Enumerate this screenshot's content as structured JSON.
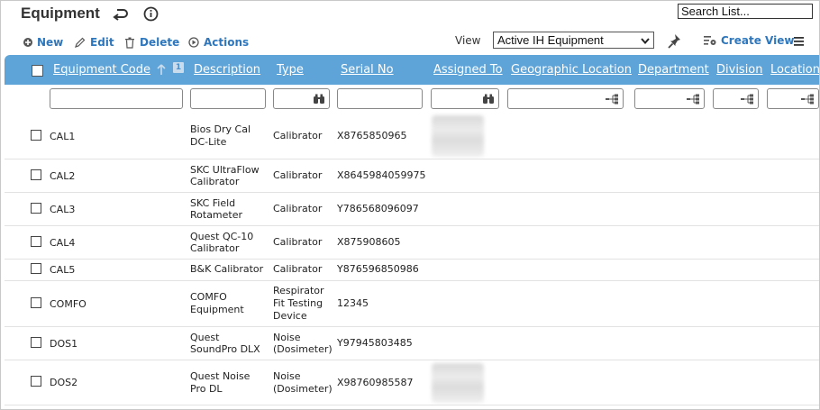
{
  "page": {
    "title": "Equipment",
    "search_placeholder": "Search List..."
  },
  "toolbar": {
    "new_label": "New",
    "edit_label": "Edit",
    "delete_label": "Delete",
    "actions_label": "Actions",
    "view_label": "View",
    "view_selected": "Active IH Equipment",
    "create_view_label": "Create View"
  },
  "colors": {
    "header_bg": "#5fa4d8",
    "link_blue": "#2e77bd"
  },
  "columns": {
    "code": "Equipment Code",
    "sort_badge": "1",
    "description": "Description",
    "type": "Type",
    "serial": "Serial No",
    "assigned": "Assigned To",
    "geo": "Geographic Location",
    "department": "Department",
    "division": "Division",
    "location": "Location"
  },
  "rows": [
    {
      "code": "CAL1",
      "desc1": "Bios Dry Cal",
      "desc2": "DC-Lite",
      "type1": "Calibrator",
      "type2": "",
      "type3": "",
      "serial": "X8765850965"
    },
    {
      "code": "CAL2",
      "desc1": "SKC UltraFlow",
      "desc2": "Calibrator",
      "type1": "Calibrator",
      "type2": "",
      "type3": "",
      "serial": "X8645984059975"
    },
    {
      "code": "CAL3",
      "desc1": "SKC Field",
      "desc2": "Rotameter",
      "type1": "Calibrator",
      "type2": "",
      "type3": "",
      "serial": "Y786568096097"
    },
    {
      "code": "CAL4",
      "desc1": "Quest QC-10",
      "desc2": "Calibrator",
      "type1": "Calibrator",
      "type2": "",
      "type3": "",
      "serial": "X875908605"
    },
    {
      "code": "CAL5",
      "desc1": "B&K Calibrator",
      "desc2": "",
      "type1": "Calibrator",
      "type2": "",
      "type3": "",
      "serial": "Y876596850986"
    },
    {
      "code": "COMFO",
      "desc1": "COMFO",
      "desc2": "Equipment",
      "type1": "Respirator",
      "type2": "Fit Testing",
      "type3": "Device",
      "serial": "12345"
    },
    {
      "code": "DOS1",
      "desc1": "Quest",
      "desc2": "SoundPro DLX",
      "type1": "Noise",
      "type2": "(Dosimeter)",
      "type3": "",
      "serial": "Y97945803485"
    },
    {
      "code": "DOS2",
      "desc1": "Quest Noise",
      "desc2": "Pro DL",
      "type1": "Noise",
      "type2": "(Dosimeter)",
      "type3": "",
      "serial": "X98760985587"
    }
  ]
}
